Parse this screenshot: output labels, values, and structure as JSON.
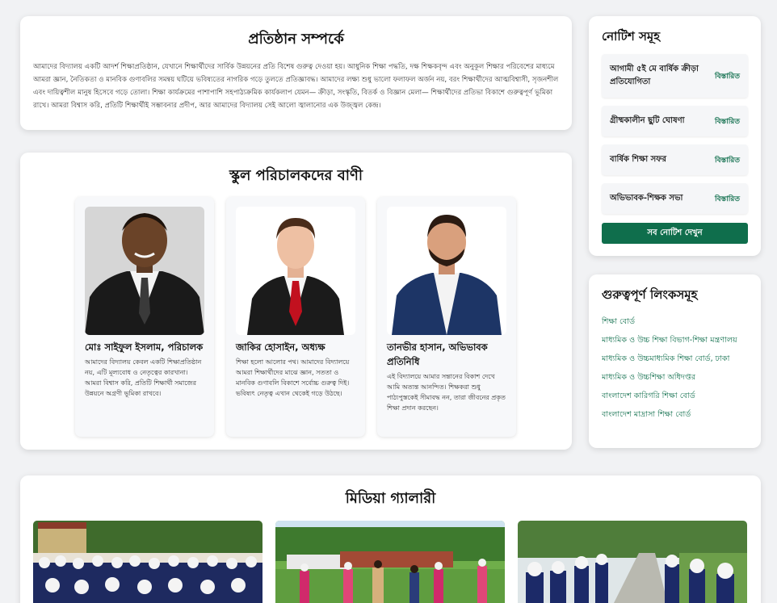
{
  "about": {
    "title": "প্রতিষ্ঠান সম্পর্কে",
    "text": "আমাদের বিদ্যালয় একটি আদর্শ শিক্ষাপ্রতিষ্ঠান, যেখানে শিক্ষার্থীদের সার্বিক উন্নয়নের প্রতি বিশেষ গুরুত্ব দেওয়া হয়। আধুনিক শিক্ষা পদ্ধতি, দক্ষ শিক্ষকবৃন্দ এবং অনুকূল শিক্ষার পরিবেশের মাধ্যমে আমরা জ্ঞান, নৈতিকতা ও মানবিক গুণাবলির সমন্বয় ঘটিয়ে ভবিষ্যতের নাগরিক গড়ে তুলতে প্রতিজ্ঞাবদ্ধ। আমাদের লক্ষ্য শুধু ভালো ফলাফল অর্জন নয়, বরং শিক্ষার্থীদের আত্মবিশ্বাসী, সৃজনশীল এবং দায়িত্বশীল মানুষ হিসেবে গড়ে তোলা। শিক্ষা কার্যক্রমের পাশাপাশি সহপাঠ্যক্রমিক কার্যকলাপ যেমন— ক্রীড়া, সংস্কৃতি, বিতর্ক ও বিজ্ঞান মেলা— শিক্ষার্থীদের প্রতিভা বিকাশে গুরুত্বপূর্ণ ভূমিকা রাখে। আমরা বিশ্বাস করি, প্রতিটি শিক্ষার্থীই সম্ভাবনার প্রদীপ, আর আমাদের বিদ্যালয় সেই আলো জ্বালানোর এক উজ্জ্বল কেন্দ্র।"
  },
  "messages": {
    "title": "স্কুল পরিচালকদের বাণী",
    "people": [
      {
        "name": "মোঃ সাইফুল ইসলাম, পরিচালক",
        "message": "আমাদের বিদ্যালয় কেবল একটি শিক্ষাপ্রতিষ্ঠান নয়, এটি মূল্যবোধ ও নেতৃত্বের কারখানা। আমরা বিশ্বাস করি, প্রতিটি শিক্ষার্থী সমাজের উন্নয়নে অগ্রণী ভূমিকা রাখবে।"
      },
      {
        "name": "জাকির হোসাইন, অধ্যক্ষ",
        "message": "শিক্ষা হলো আলোর পথ। আমাদের বিদ্যালয়ে আমরা শিক্ষার্থীদের মাঝে জ্ঞান, সততা ও মানবিক গুণাবলি বিকাশে সর্বোচ্চ গুরুত্ব দিই। ভবিষ্যৎ নেতৃত্ব এখান থেকেই গড়ে উঠছে।"
      },
      {
        "name": "তানভীর হাসান, অভিভাবক প্রতিনিধি",
        "message": "এই বিদ্যালয়ে আমার সন্তানের বিকাশ দেখে আমি অত্যন্ত আনন্দিত। শিক্ষকরা শুধু পাঠ্যপুস্তকেই সীমাবদ্ধ নন, তারা জীবনের প্রকৃত শিক্ষা প্রদান করছেন।"
      }
    ]
  },
  "notice": {
    "title": "নোটিশ সমূহ",
    "items": [
      {
        "title": "আগামী ৫ই মে বার্ষিক ক্রীড়া প্রতিযোগিতা",
        "link": "বিস্তারিত"
      },
      {
        "title": "গ্রীষ্মকালীন ছুটি ঘোষণা",
        "link": "বিস্তারিত"
      },
      {
        "title": "বার্ষিক শিক্ষা সফর",
        "link": "বিস্তারিত"
      },
      {
        "title": "অভিভাবক-শিক্ষক সভা",
        "link": "বিস্তারিত"
      }
    ],
    "all_button": "সব নোটিশ দেখুন"
  },
  "links": {
    "title": "গুরুত্বপূর্ণ লিংকসমূহ",
    "items": [
      "শিক্ষা বোর্ড",
      "মাধ্যমিক ও উচ্চ শিক্ষা বিভাগ-শিক্ষা মন্ত্রণালয়",
      "মাধ্যমিক ও উচ্চমাধ্যমিক শিক্ষা বোর্ড, ঢাকা",
      "মাধ্যমিক ও উচ্চশিক্ষা অধিদপ্তর",
      "বাংলাদেশ কারিগরি শিক্ষা বোর্ড",
      "বাংলাদেশ মাদ্রাসা শিক্ষা বোর্ড"
    ]
  },
  "media": {
    "title": "মিডিয়া গ্যালারী"
  }
}
